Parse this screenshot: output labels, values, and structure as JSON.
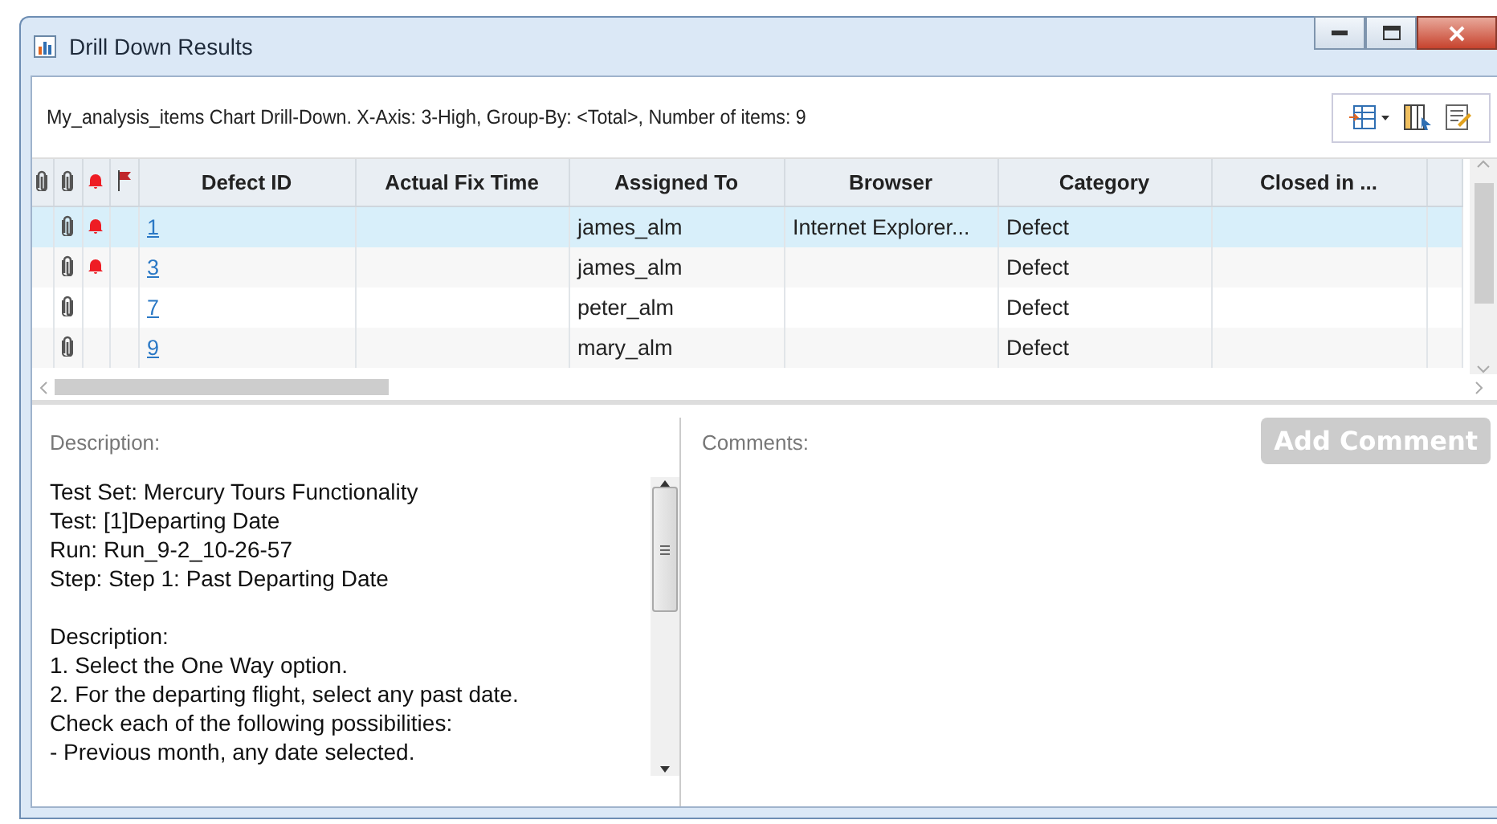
{
  "window": {
    "title": "Drill Down Results"
  },
  "summary": "My_analysis_items Chart Drill-Down. X-Axis: 3-High, Group-By: <Total>, Number of items: 9",
  "table": {
    "columns": [
      "Defect ID",
      "Actual Fix Time",
      "Assigned To",
      "Browser",
      "Category",
      "Closed in ..."
    ],
    "rows": [
      {
        "selected": true,
        "attachment": true,
        "alert": true,
        "id": "1",
        "fix_time": "",
        "assigned": "james_alm",
        "browser": "Internet Explorer...",
        "category": "Defect"
      },
      {
        "selected": false,
        "attachment": true,
        "alert": true,
        "id": "3",
        "assigned": "james_alm",
        "category": "Defect"
      },
      {
        "selected": false,
        "attachment": true,
        "alert": false,
        "id": "7",
        "assigned": "peter_alm",
        "category": "Defect"
      },
      {
        "selected": false,
        "attachment": true,
        "alert": false,
        "id": "9",
        "assigned": "mary_alm",
        "category": "Defect"
      }
    ]
  },
  "description": {
    "label": "Description:",
    "paragraphs": [
      [
        "Test Set: Mercury Tours Functionality",
        "Test: [1]Departing Date",
        "Run: Run_9-2_10-26-57",
        "Step: Step 1: Past Departing Date"
      ],
      [
        "Description:",
        "1. Select the One Way option.",
        "2. For the departing flight, select any past date.",
        "Check each of the following possibilities:",
        "- Previous month, any date selected."
      ]
    ]
  },
  "comments": {
    "label": "Comments:",
    "button": {
      "label": "Add Comment",
      "disabled": true
    }
  }
}
